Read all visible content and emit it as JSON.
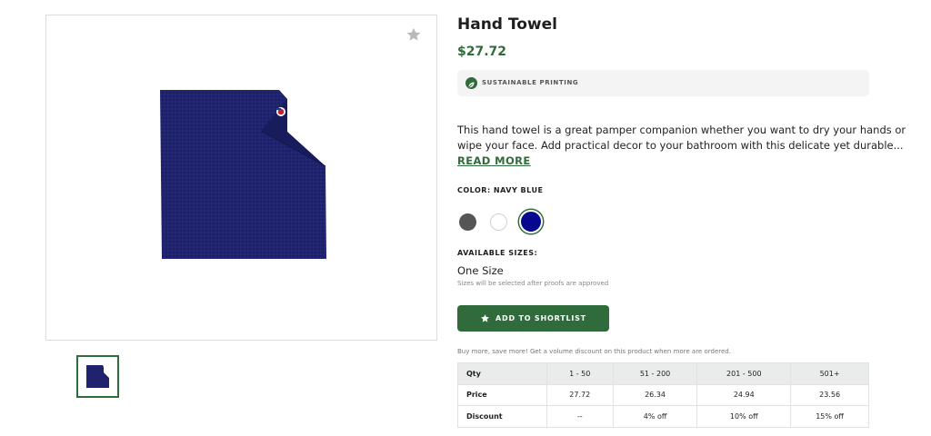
{
  "product": {
    "title": "Hand Towel",
    "price": "$27.72",
    "badge": "SUSTAINABLE PRINTING",
    "description_lines": [
      "This hand towel is a great pamper companion whether you want to dry your hands or",
      "wipe your face. Add practical decor to your bathroom with this delicate yet durable..."
    ],
    "read_more": "READ MORE"
  },
  "color": {
    "label": "COLOR: NAVY BLUE",
    "swatches": [
      "#555555",
      "#ffffff",
      "#06068f"
    ],
    "selected": "#06068f"
  },
  "sizes": {
    "label": "AVAILABLE SIZES:",
    "value": "One Size",
    "note": "Sizes will be selected after proofs are approved"
  },
  "actions": {
    "shortlist_label": "ADD TO SHORTLIST",
    "favorite_icon": "star-icon"
  },
  "volume": {
    "note": "Buy more, save more! Get a volume discount on this product when more are ordered.",
    "headers": [
      "Qty",
      "1 - 50",
      "51 - 200",
      "201 - 500",
      "501+"
    ],
    "rows": [
      [
        "Price",
        "27.72",
        "26.34",
        "24.94",
        "23.56"
      ],
      [
        "Discount",
        "--",
        "4% off",
        "10% off",
        "15% off"
      ]
    ]
  },
  "colors": {
    "accent": "#2f6b3b",
    "towel": "#1f236e"
  }
}
